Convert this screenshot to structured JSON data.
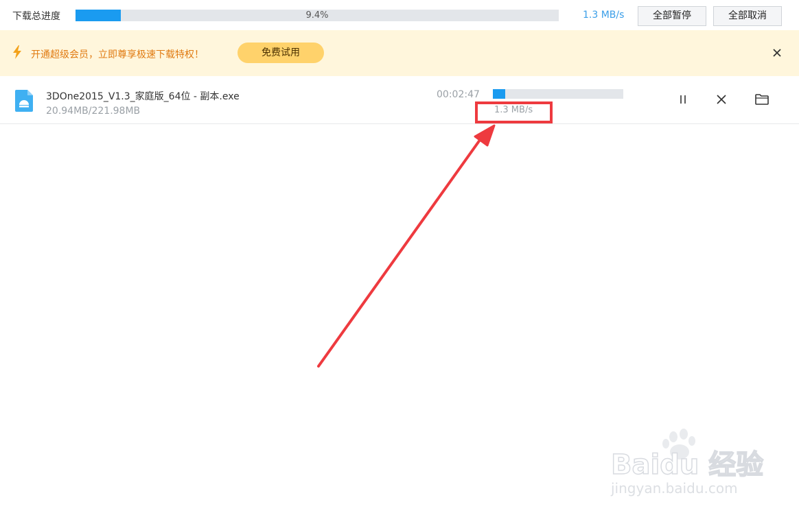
{
  "header": {
    "title": "下载总进度",
    "total_progress_text": "9.4%",
    "total_progress_fraction": 0.094,
    "speed": "1.3 MB/s",
    "pause_all_label": "全部暂停",
    "cancel_all_label": "全部取消"
  },
  "promo": {
    "icon": "lightning-icon",
    "text": "开通超级会员，立即尊享极速下载特权！",
    "trial_label": "免费试用",
    "close_icon": "close-icon"
  },
  "downloads": [
    {
      "icon": "file-exe-icon",
      "name": "3DOne2015_V1.3_家庭版_64位 - 副本.exe",
      "size": "20.94MB/221.98MB",
      "time_remaining": "00:02:47",
      "progress_fraction": 0.094,
      "speed": "1.3 MB/s",
      "actions": [
        "pause-icon",
        "close-icon",
        "folder-icon"
      ]
    }
  ],
  "colors": {
    "accent": "#1a9bf0",
    "promo_bg": "#fff6dc",
    "promo_text": "#e07b12",
    "trial_button": "#ffd26b",
    "annotation": "#ee3a3f"
  },
  "watermark": {
    "brand": "Baidu 经验",
    "url": "jingyan.baidu.com"
  }
}
